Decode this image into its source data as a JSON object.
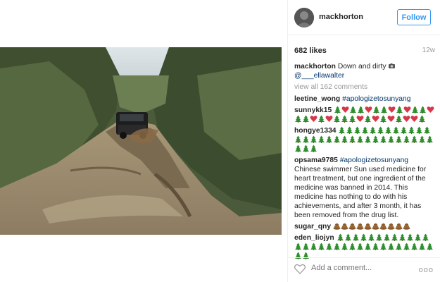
{
  "post": {
    "author": "mackhorton",
    "follow_label": "Follow",
    "likes": "682 likes",
    "age": "12w",
    "caption_text": "Down and dirty",
    "caption_mention": "@___ellawalter",
    "view_all": "view all 162 comments"
  },
  "comments": [
    {
      "user": "leetine_wong",
      "text": "#apologizetosunyang"
    },
    {
      "user": "sunnykk15",
      "emoji": [
        "tree",
        "heart",
        "tree",
        "tree",
        "heart",
        "tree",
        "tree",
        "heart",
        "tree",
        "heart",
        "tree",
        "tree",
        "heart",
        "tree",
        "tree",
        "heart",
        "tree",
        "heart",
        "tree",
        "tree",
        "tree",
        "heart",
        "tree",
        "heart",
        "tree",
        "heart",
        "tree",
        "heart",
        "heart",
        "tree"
      ]
    },
    {
      "user": "hongye1334",
      "emoji": [
        "tree",
        "tree",
        "tree",
        "tree",
        "tree",
        "tree",
        "tree",
        "tree",
        "tree",
        "tree",
        "tree",
        "tree",
        "tree",
        "tree",
        "tree",
        "tree",
        "tree",
        "tree",
        "tree",
        "tree",
        "tree",
        "tree",
        "tree",
        "tree",
        "tree",
        "tree",
        "tree",
        "tree",
        "tree",
        "tree",
        "tree",
        "tree",
        "tree"
      ]
    },
    {
      "user": "opsama9785",
      "tag": "#apologizetosunyang",
      "text": "Chinese swimmer Sun used medicine for heart treatment, but one ingredient of the medicine was banned in 2014. This medicine has nothing to do with his achievements, and after 3 month, it has been removed from the drug list."
    },
    {
      "user": "sugar_qny",
      "emoji": [
        "poo",
        "poo",
        "poo",
        "poo",
        "poo",
        "poo",
        "poo",
        "poo",
        "poo",
        "poo"
      ]
    },
    {
      "user": "eden_liojyn",
      "emoji": [
        "tree",
        "tree",
        "tree",
        "tree",
        "tree",
        "tree",
        "tree",
        "tree",
        "tree",
        "tree",
        "tree",
        "tree",
        "tree",
        "tree",
        "tree",
        "tree",
        "tree",
        "tree",
        "tree",
        "tree",
        "tree",
        "tree",
        "tree",
        "tree",
        "tree",
        "tree",
        "tree",
        "tree",
        "tree",
        "tree",
        "tree",
        "tree"
      ]
    }
  ],
  "add_comment": {
    "placeholder": "Add a comment..."
  },
  "more_label": "ooo",
  "colors": {
    "link": "#003569",
    "follow": "#3897f0",
    "muted": "#999999"
  }
}
